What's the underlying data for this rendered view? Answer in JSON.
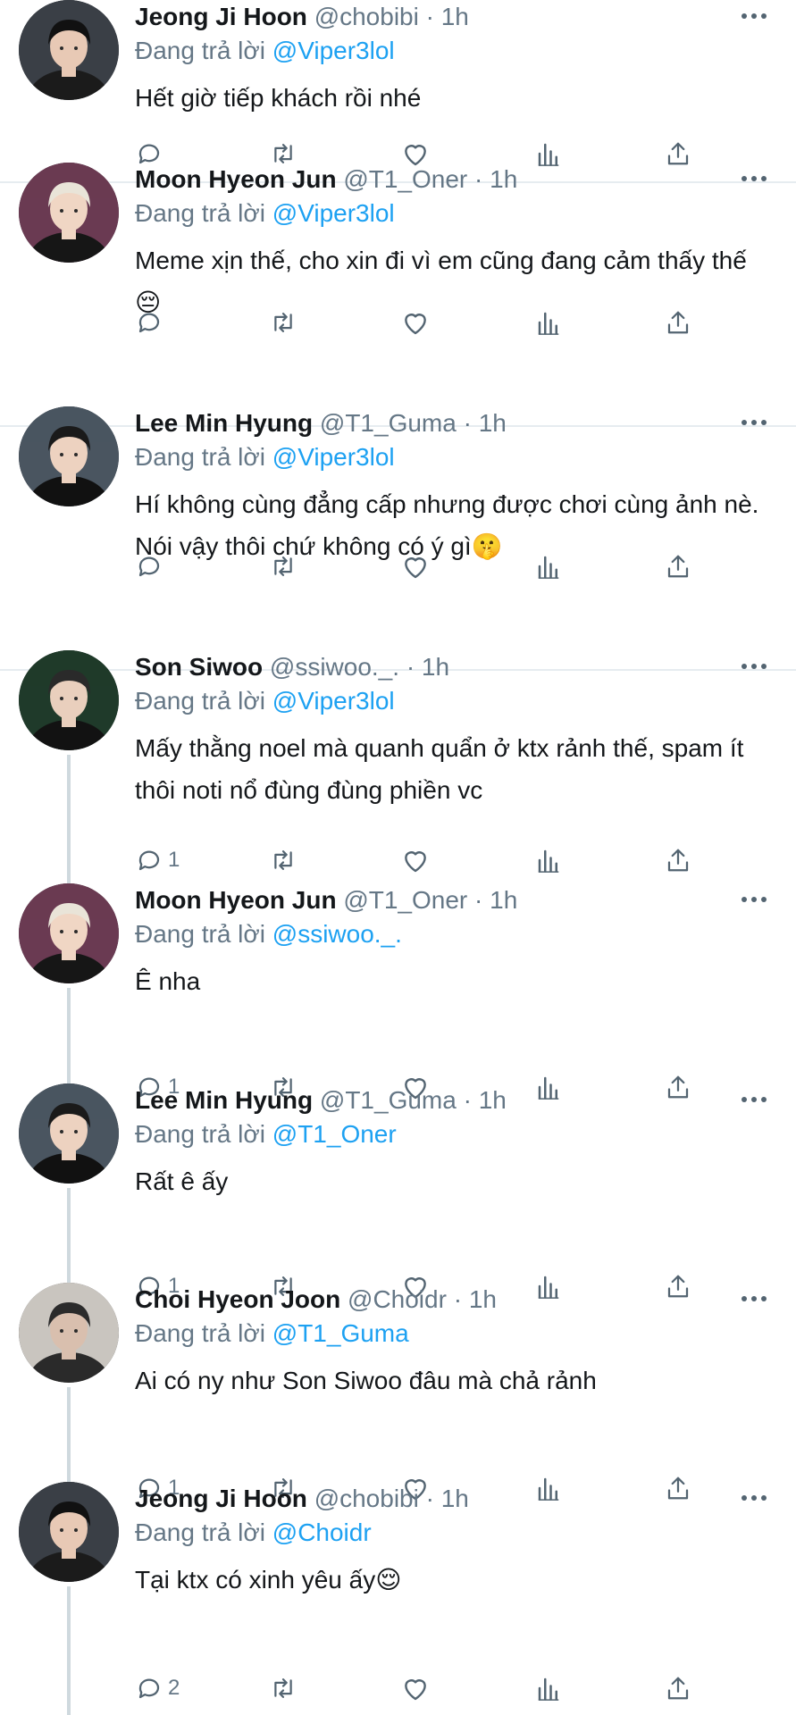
{
  "reply_prefix": "Đang trả lời",
  "tweets": [
    {
      "name": "Jeong Ji Hoon",
      "handle": "@chobibi",
      "dot": "·",
      "time": "1h",
      "reply_to": "@Viper3lol",
      "text": "Hết giờ tiếp khách rồi nhé",
      "replies": "",
      "avatar": "avatar-jeong-ji-hoon"
    },
    {
      "name": "Moon Hyeon Jun",
      "handle": "@T1_Oner",
      "dot": "·",
      "time": "1h",
      "reply_to": "@Viper3lol",
      "text": "Meme xịn thế, cho xin đi vì em cũng đang cảm thấy thế😔",
      "replies": "",
      "avatar": "avatar-moon-hyeon-jun"
    },
    {
      "name": "Lee Min Hyung",
      "handle": "@T1_Guma",
      "dot": "·",
      "time": "1h",
      "reply_to": "@Viper3lol",
      "text": "Hí không cùng đẳng cấp nhưng được chơi cùng ảnh nè. Nói vậy thôi chứ không có ý gì🤫",
      "replies": "",
      "avatar": "avatar-lee-min-hyung"
    },
    {
      "name": "Son Siwoo",
      "handle": "@ssiwoo._.",
      "dot": "·",
      "time": "1h",
      "reply_to": "@Viper3lol",
      "text": "Mấy thằng noel mà quanh quẩn ở ktx rảnh thế, spam ít thôi noti nổ đùng đùng phiền vc",
      "replies": "1",
      "avatar": "avatar-son-siwoo"
    },
    {
      "name": "Moon Hyeon Jun",
      "handle": "@T1_Oner",
      "dot": "·",
      "time": "1h",
      "reply_to": "@ssiwoo._.",
      "text": "Ê nha",
      "replies": "1",
      "avatar": "avatar-moon-hyeon-jun"
    },
    {
      "name": "Lee Min Hyung",
      "handle": "@T1_Guma",
      "dot": "·",
      "time": "1h",
      "reply_to": "@T1_Oner",
      "text": "Rất ê ấy",
      "replies": "1",
      "avatar": "avatar-lee-min-hyung"
    },
    {
      "name": "Choi Hyeon Joon",
      "handle": "@Choidr",
      "dot": "·",
      "time": "1h",
      "reply_to": "@T1_Guma",
      "text": "Ai có ny như Son Siwoo đâu mà chả rảnh",
      "replies": "1",
      "avatar": "avatar-choi-hyeon-joon"
    },
    {
      "name": "Jeong Ji Hoon",
      "handle": "@chobibi",
      "dot": "·",
      "time": "1h",
      "reply_to": "@Choidr",
      "text": "Tại ktx có xinh yêu ấy😌",
      "replies": "2",
      "avatar": "avatar-jeong-ji-hoon"
    }
  ],
  "colors": {
    "accent": "#1da1f2",
    "muted": "#657786",
    "icon": "#536471",
    "divider": "#e6ecf0",
    "thread_line": "#cfd9de"
  },
  "icons": [
    "reply-icon",
    "retweet-icon",
    "like-icon",
    "stats-icon",
    "share-icon",
    "more-icon"
  ]
}
